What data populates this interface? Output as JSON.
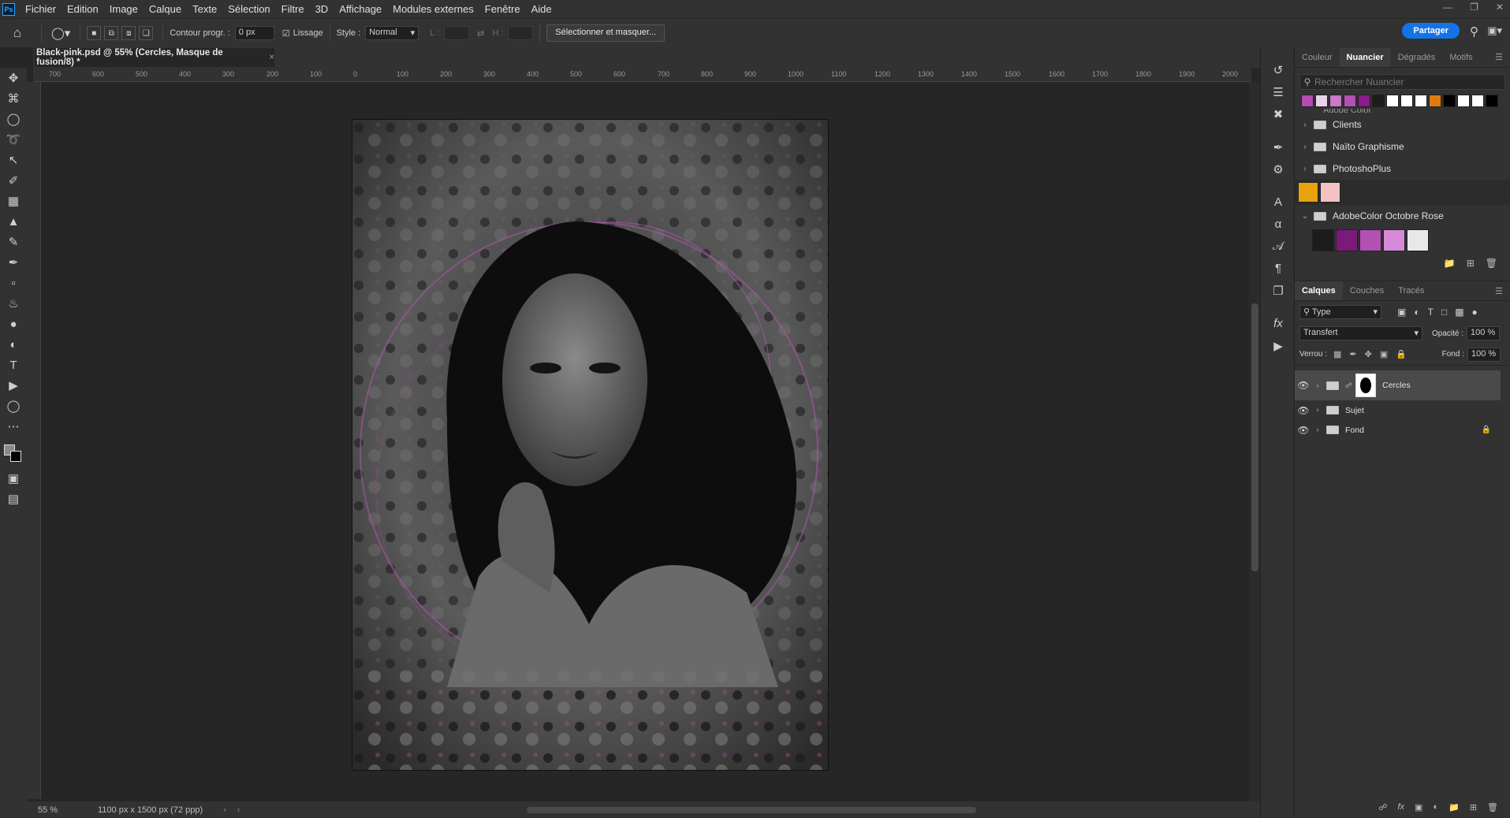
{
  "menu": {
    "app_logo": "Ps",
    "items": [
      "Fichier",
      "Edition",
      "Image",
      "Calque",
      "Texte",
      "Sélection",
      "Filtre",
      "3D",
      "Affichage",
      "Modules externes",
      "Fenêtre",
      "Aide"
    ]
  },
  "options": {
    "feather_label": "Contour progr. :",
    "feather_value": "0 px",
    "smoothing_label": "Lissage",
    "style_label": "Style :",
    "style_value": "Normal",
    "width_label": "L :",
    "height_label": "H :",
    "select_mask_button": "Sélectionner et masquer...",
    "share_button": "Partager"
  },
  "document": {
    "tab_title": "Black-pink.psd @ 55% (Cercles, Masque de fusion/8) *",
    "zoom": "55 %",
    "doc_info": "1100 px x 1500 px (72 ppp)"
  },
  "ruler": {
    "labels": [
      "700",
      "600",
      "500",
      "400",
      "300",
      "200",
      "100",
      "0",
      "100",
      "200",
      "300",
      "400",
      "500",
      "600",
      "700",
      "800",
      "900",
      "1000",
      "1100",
      "1200",
      "1300",
      "1400",
      "1500",
      "1600",
      "1700",
      "1800",
      "1900",
      "2000"
    ]
  },
  "swatches_panel": {
    "tabs": [
      "Couleur",
      "Nuancier",
      "Dégradés",
      "Motifs"
    ],
    "active_tab": "Nuancier",
    "search_placeholder": "Rechercher Nuancier",
    "recent_colors": [
      "#b34db3",
      "#e8d4e8",
      "#c879c8",
      "#b350b3",
      "#8b1a8b",
      "#1c1c1c",
      "#ffffff",
      "#ffffff",
      "#ffffff",
      "#e07b10",
      "#000000",
      "#ffffff",
      "#ffffff",
      "#000000"
    ],
    "partial_group": "Adobe Color",
    "groups": [
      "Clients",
      "Naïto Graphisme",
      "PhotoshoPlus"
    ],
    "loose_swatches": [
      "#e8a20c",
      "#f4c2c2"
    ],
    "open_group": "AdobeColor Octobre Rose",
    "open_group_swatches": [
      "#1c1c1c",
      "#7a1a7a",
      "#b350b3",
      "#d78ad7",
      "#e8e8e8"
    ]
  },
  "layers_panel": {
    "tabs": [
      "Calques",
      "Couches",
      "Tracés"
    ],
    "active_tab": "Calques",
    "filter": "Type",
    "blend_mode": "Transfert",
    "opacity_label": "Opacité :",
    "opacity": "100 %",
    "lock_label": "Verrou :",
    "fill_label": "Fond :",
    "fill": "100 %",
    "layers": [
      {
        "name": "Cercles",
        "selected": true,
        "locked": false
      },
      {
        "name": "Sujet",
        "selected": false,
        "locked": false
      },
      {
        "name": "Fond",
        "selected": false,
        "locked": true
      }
    ]
  },
  "colors": {
    "accent": "#1473e6",
    "panel": "#323232",
    "workspace": "#262626",
    "selection": "#4a4a4a"
  }
}
